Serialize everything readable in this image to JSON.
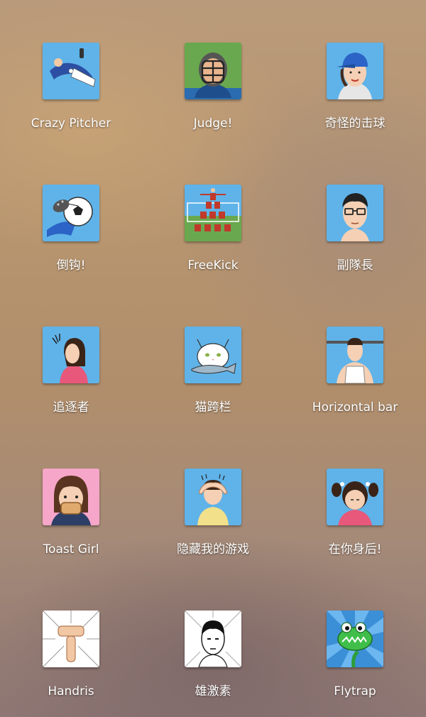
{
  "apps": [
    {
      "label": "Crazy Pitcher",
      "icon": "pitcher-icon"
    },
    {
      "label": "Judge!",
      "icon": "umpire-mask-icon"
    },
    {
      "label": "奇怪的击球",
      "icon": "baseball-cap-girl-icon"
    },
    {
      "label": "倒钩!",
      "icon": "bicycle-kick-icon"
    },
    {
      "label": "FreeKick",
      "icon": "soccer-wall-icon"
    },
    {
      "label": "副隊長",
      "icon": "glasses-man-icon"
    },
    {
      "label": "追逐者",
      "icon": "girl-profile-icon"
    },
    {
      "label": "猫跨栏",
      "icon": "cat-fish-icon"
    },
    {
      "label": "Horizontal bar",
      "icon": "horizontal-bar-man-icon"
    },
    {
      "label": "Toast Girl",
      "icon": "toast-girl-icon"
    },
    {
      "label": "隐藏我的游戏",
      "icon": "boy-hands-on-head-icon"
    },
    {
      "label": "在你身后!",
      "icon": "pigtail-girl-icon"
    },
    {
      "label": "Handris",
      "icon": "hand-block-icon"
    },
    {
      "label": "雄激素",
      "icon": "manga-man-face-icon"
    },
    {
      "label": "Flytrap",
      "icon": "green-crocodile-icon"
    }
  ],
  "colors": {
    "label_text": "#ffffff",
    "icon_sky_blue": "#5fb3e9",
    "icon_pink": "#f6a6c9",
    "icon_green": "#6aa84f"
  }
}
